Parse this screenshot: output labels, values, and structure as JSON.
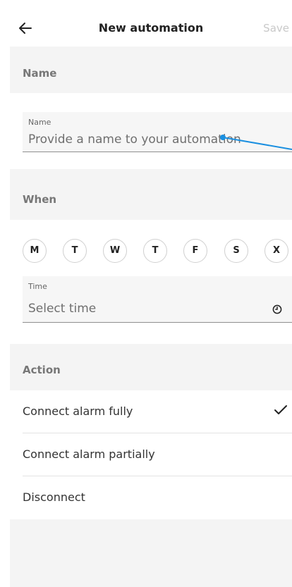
{
  "header": {
    "title": "New automation",
    "save_label": "Save",
    "back_icon": "arrow-left-icon"
  },
  "name_section": {
    "title": "Name",
    "field_label": "Name",
    "placeholder": "Provide a name to your automation"
  },
  "when_section": {
    "title": "When",
    "days": [
      "M",
      "T",
      "W",
      "T",
      "F",
      "S",
      "X"
    ],
    "time_label": "Time",
    "time_placeholder": "Select time",
    "clock_icon": "clock-icon"
  },
  "action_section": {
    "title": "Action",
    "options": [
      {
        "label": "Connect alarm fully",
        "selected": true
      },
      {
        "label": "Connect alarm partially",
        "selected": false
      },
      {
        "label": "Disconnect",
        "selected": false
      }
    ],
    "check_icon": "check-icon"
  },
  "colors": {
    "section_background": "#f4f4f4",
    "field_background": "#f6f6f6",
    "disabled_text": "#c9c9c9",
    "pointer_accent": "#1a8fe0"
  }
}
